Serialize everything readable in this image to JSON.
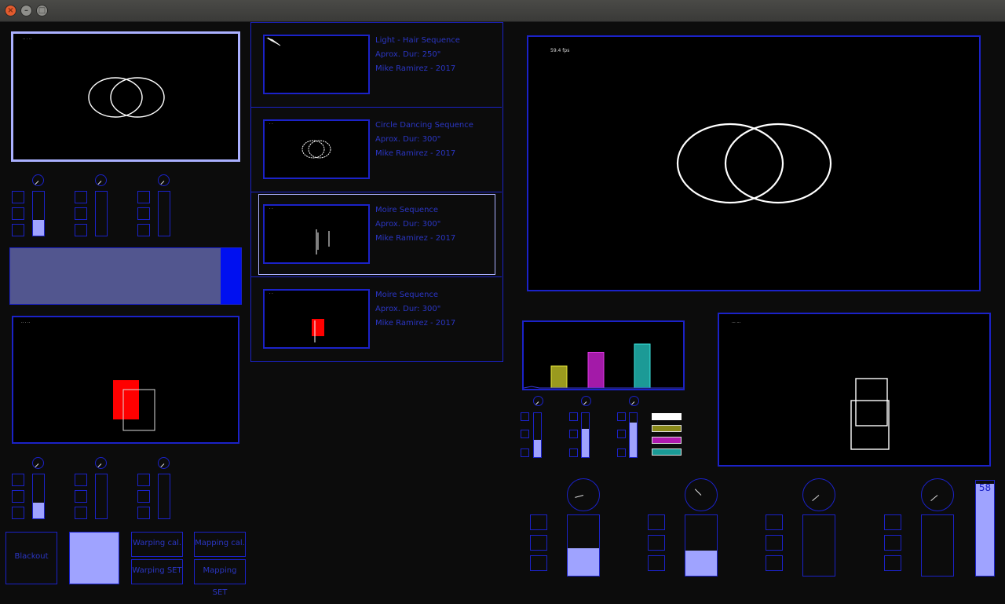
{
  "window": {
    "close": "×",
    "minimize": "–",
    "maximize": "□"
  },
  "left_top_preview": {
    "label": "·· · ··"
  },
  "left_bottom_preview": {
    "label": "·· · ··"
  },
  "sequences": [
    {
      "title": "Light - Hair Sequence",
      "duration": "Aprox. Dur: 250\"",
      "author": "Mike Ramirez - 2017",
      "thumb_label": "· ·"
    },
    {
      "title": "Circle Dancing Sequence",
      "duration": "Aprox. Dur: 300\"",
      "author": "Mike Ramirez - 2017",
      "thumb_label": "· ·"
    },
    {
      "title": "Moire Sequence",
      "duration": "Aprox. Dur: 300\"",
      "author": "Mike Ramirez - 2017",
      "thumb_label": "· ·"
    },
    {
      "title": "Moire Sequence",
      "duration": "Aprox. Dur: 300\"",
      "author": "Mike Ramirez - 2017",
      "thumb_label": "· ·"
    }
  ],
  "main_output": {
    "label": "59.4 fps"
  },
  "mapping_preview": {
    "label": "··· ···"
  },
  "buttons": {
    "blackout": "Blackout",
    "warping_cal": "Warping cal.",
    "warping_set": "Warping SET",
    "mapping_cal": "Mapping cal.",
    "mapping_set": "Mapping SET"
  },
  "master_fader": {
    "value": "58",
    "level": 0.97
  },
  "top_faders": [
    0.35,
    0,
    0
  ],
  "bottom_faders": [
    0.35,
    0,
    0
  ],
  "crossfade": {
    "level": 0.91
  },
  "audio_faders": [
    0.4,
    0.65,
    0.78
  ],
  "audio_bands": [
    {
      "color": "#9a9a1e",
      "level": 0.4
    },
    {
      "color": "#a31aa8",
      "level": 0.65
    },
    {
      "color": "#1c9a96",
      "level": 0.8
    }
  ],
  "swatches": [
    "#ffffff",
    "#8a8a1a",
    "#b01ab0",
    "#1a9a96"
  ],
  "big_faders": [
    0.45,
    0.42,
    0,
    0
  ],
  "colors": {
    "accent": "#1b22c8",
    "fill": "#9fa3ff",
    "highlight": "#aab0ff"
  }
}
